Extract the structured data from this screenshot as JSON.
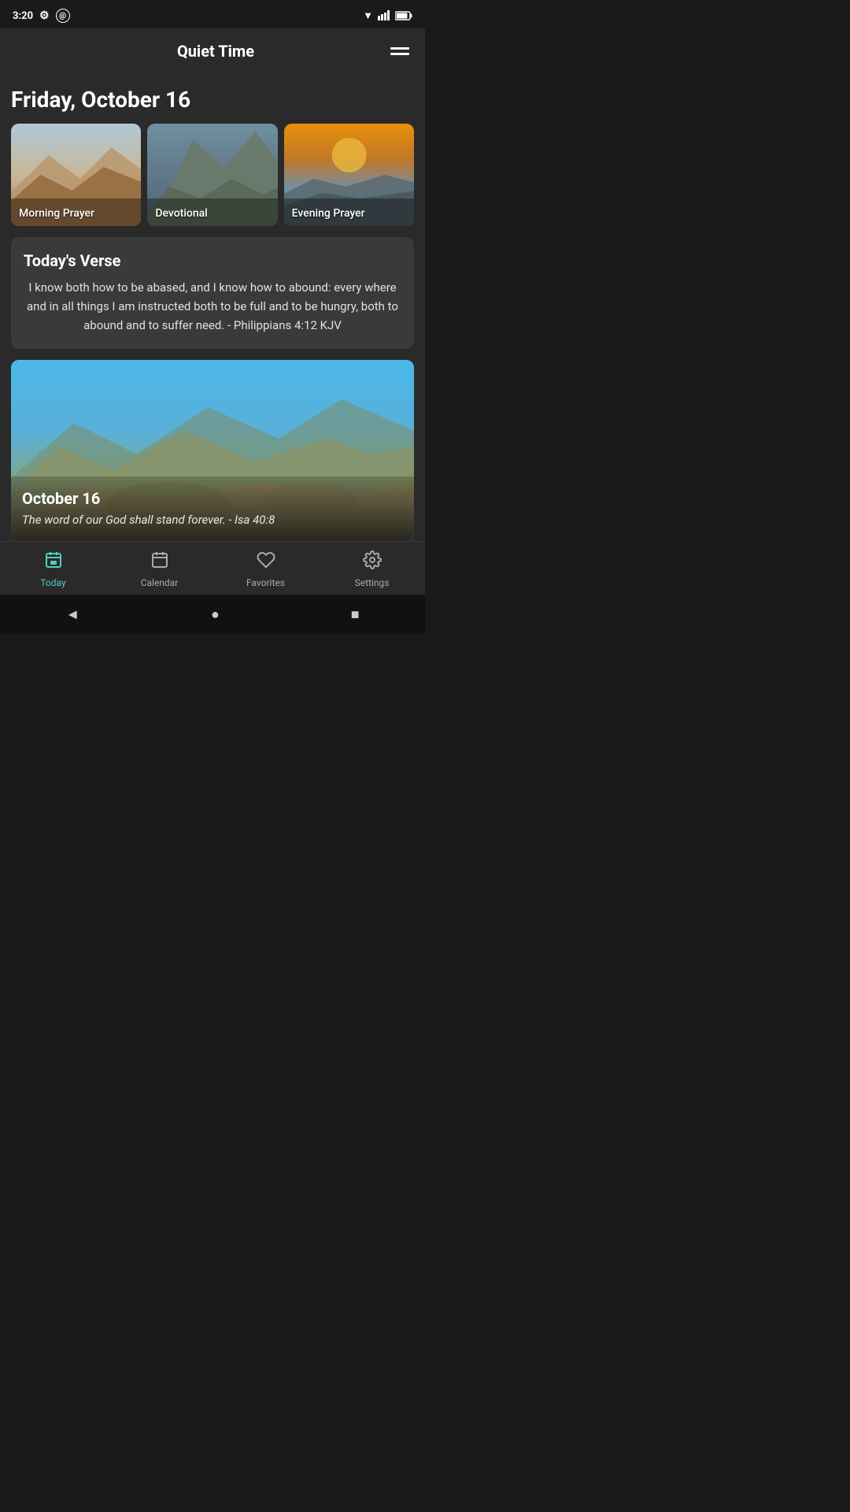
{
  "statusBar": {
    "time": "3:20",
    "icons": [
      "settings",
      "at-symbol",
      "wifi",
      "signal",
      "battery"
    ]
  },
  "header": {
    "title": "Quiet Time",
    "menuIcon": "menu"
  },
  "dateHeader": "Friday, October 16",
  "prayerCards": [
    {
      "id": "morning-prayer",
      "label": "Morning Prayer",
      "theme": "desert"
    },
    {
      "id": "devotional",
      "label": "Devotional",
      "theme": "mountain"
    },
    {
      "id": "evening-prayer",
      "label": "Evening Prayer",
      "theme": "sunset"
    }
  ],
  "verseSection": {
    "title": "Today's Verse",
    "text": "I know both how to be abased, and I know how to abound: every where and in all things I am instructed both to be full and to be hungry, both to abound and to suffer need. - Philippians 4:12 KJV"
  },
  "featureCard": {
    "date": "October 16",
    "quote": "The word of our God shall stand forever. - Isa 40:8"
  },
  "bottomNav": [
    {
      "id": "today",
      "label": "Today",
      "icon": "📅",
      "active": true
    },
    {
      "id": "calendar",
      "label": "Calendar",
      "icon": "📆",
      "active": false
    },
    {
      "id": "favorites",
      "label": "Favorites",
      "icon": "♥",
      "active": false
    },
    {
      "id": "settings",
      "label": "Settings",
      "icon": "⚙",
      "active": false
    }
  ],
  "androidNav": {
    "back": "◄",
    "home": "●",
    "recent": "■"
  }
}
